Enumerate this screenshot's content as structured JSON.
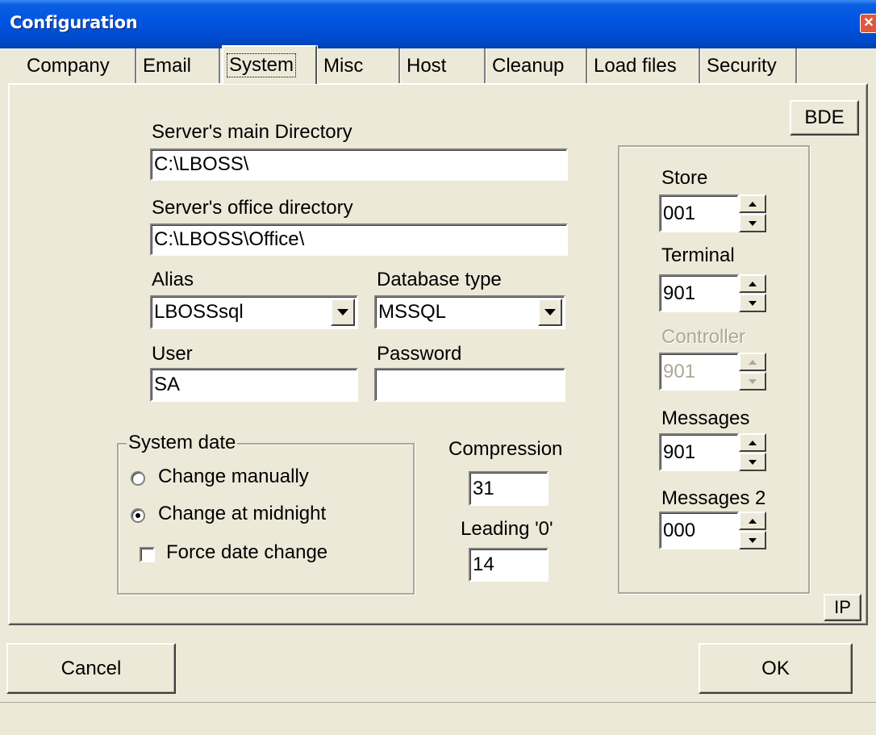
{
  "window": {
    "title": "Configuration"
  },
  "tabs": [
    "Company",
    "Email",
    "System",
    "Misc",
    "Host",
    "Cleanup",
    "Load files",
    "Security"
  ],
  "system": {
    "bde_label": "BDE",
    "ip_label": "IP",
    "server_main_dir": {
      "label": "Server's main Directory",
      "value": "C:\\LBOSS\\"
    },
    "server_office_dir": {
      "label": "Server's office directory",
      "value": "C:\\LBOSS\\Office\\"
    },
    "alias": {
      "label": "Alias",
      "value": "LBOSSsql"
    },
    "database_type": {
      "label": "Database type",
      "value": "MSSQL"
    },
    "user": {
      "label": "User",
      "value": "SA"
    },
    "password": {
      "label": "Password",
      "value": ""
    },
    "system_date": {
      "title": "System date",
      "change_manually": "Change manually",
      "change_at_midnight": "Change at midnight",
      "selected": "Change at midnight",
      "force_date_change": "Force date change",
      "force_checked": false
    },
    "compression": {
      "label": "Compression",
      "value": "31"
    },
    "leading_zero": {
      "label": "Leading '0'",
      "value": "14"
    },
    "store": {
      "label": "Store",
      "value": "001"
    },
    "terminal": {
      "label": "Terminal",
      "value": "901"
    },
    "controller": {
      "label": "Controller",
      "value": "901",
      "enabled": false
    },
    "messages": {
      "label": "Messages",
      "value": "901"
    },
    "messages2": {
      "label": "Messages 2",
      "value": "000"
    }
  },
  "footer": {
    "cancel_label": "Cancel",
    "ok_label": "OK"
  }
}
